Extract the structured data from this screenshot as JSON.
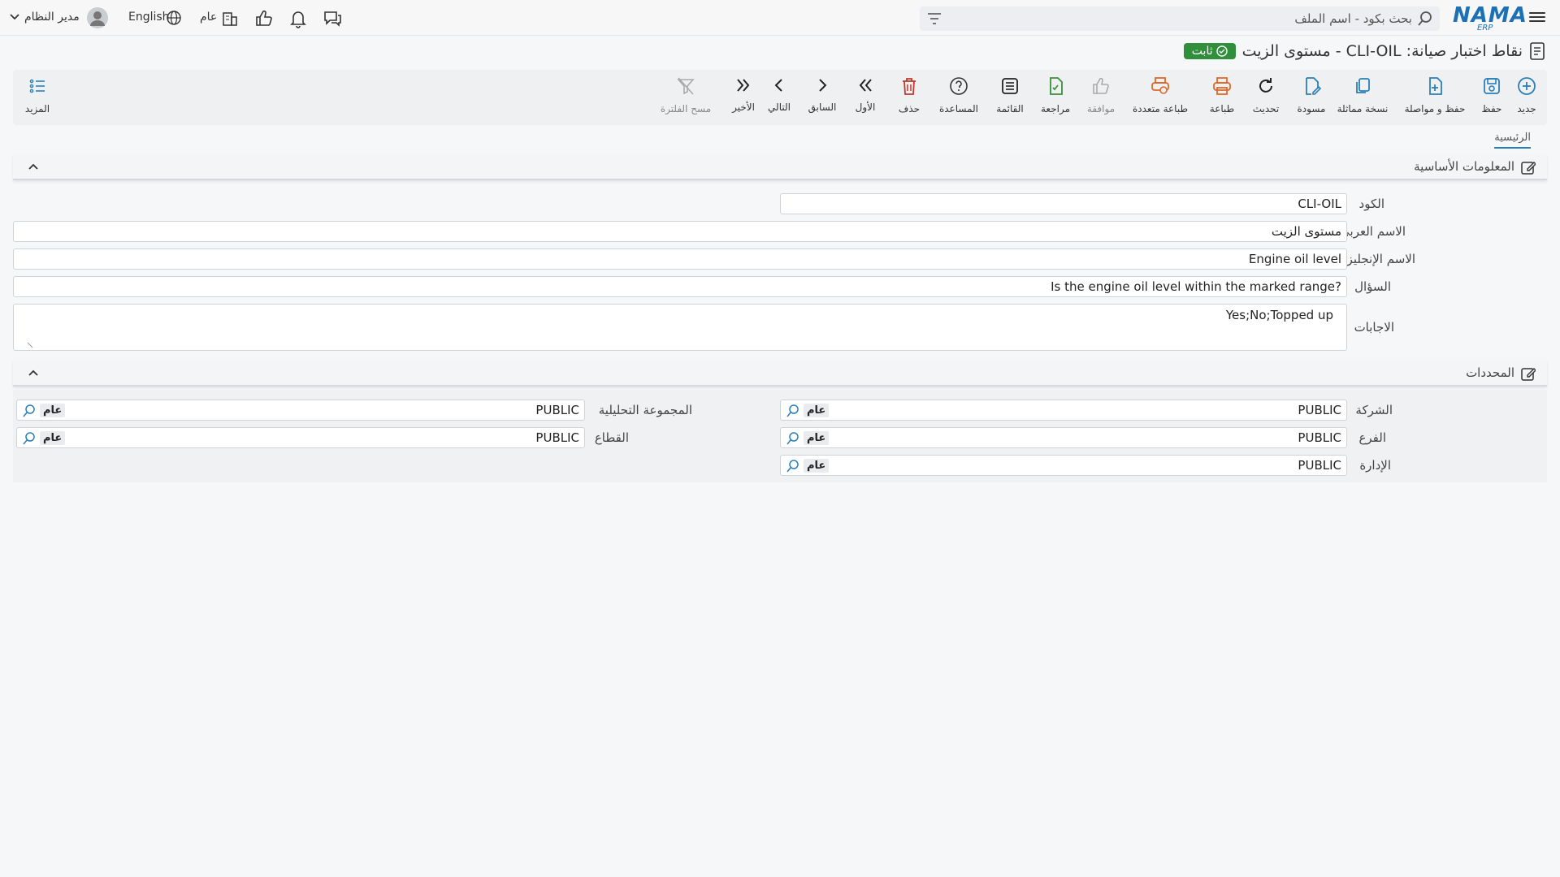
{
  "topbar": {
    "search_placeholder": "بحث بكود - اسم الملف",
    "logo_text": "NAMA",
    "logo_sub": "ERP",
    "language_label": "English",
    "public_label": "عام",
    "user_label": "مدير النظام"
  },
  "title": {
    "text": "نقاط اختبار صيانة: CLI-OIL - مستوى الزيت",
    "badge": "ثابت"
  },
  "toolbar": {
    "new": "جديد",
    "save": "حفظ",
    "save_continue": "حفظ و مواصلة",
    "duplicate": "نسخة مماثلة",
    "draft": "مسودة",
    "refresh": "تحديث",
    "print": "طباعة",
    "multi_print": "طباعة متعددة",
    "approve": "موافقة",
    "review": "مراجعة",
    "list": "القائمة",
    "help": "المساعدة",
    "delete": "حذف",
    "first": "الأول",
    "previous": "السابق",
    "next": "التالي",
    "last": "الأخير",
    "clear_filter": "مسح الفلترة",
    "more": "المزيد"
  },
  "tabs": {
    "home": "الرئيسية"
  },
  "basic_info": {
    "heading": "المعلومات الأساسية",
    "code_label": "الكود",
    "code_value": "CLI-OIL",
    "arabic_name_label": "الاسم العربي",
    "arabic_name_value": "مستوى الزيت",
    "english_name_label": "الاسم الإنجليزي",
    "english_name_value": "Engine oil level",
    "question_label": "السؤال",
    "question_value": "Is the engine oil level within the marked range?",
    "answers_label": "الاجابات",
    "answers_value": "Yes;No;Topped up"
  },
  "dimensions": {
    "heading": "المحددات",
    "company_label": "الشركة",
    "company_value": "PUBLIC",
    "company_tag": "عام",
    "branch_label": "الفرع",
    "branch_value": "PUBLIC",
    "branch_tag": "عام",
    "department_label": "الإدارة",
    "department_value": "PUBLIC",
    "department_tag": "عام",
    "analysis_group_label": "المجموعة التحليلية",
    "analysis_group_value": "PUBLIC",
    "analysis_group_tag": "عام",
    "sector_label": "القطاع",
    "sector_value": "PUBLIC",
    "sector_tag": "عام"
  },
  "colors": {
    "brand": "#1c70b6",
    "badge_green": "#2f8f3a",
    "icon_blue": "#2a7fb8",
    "icon_orange": "#e0662a",
    "icon_green": "#3a8f3a",
    "icon_red": "#c0392b"
  }
}
